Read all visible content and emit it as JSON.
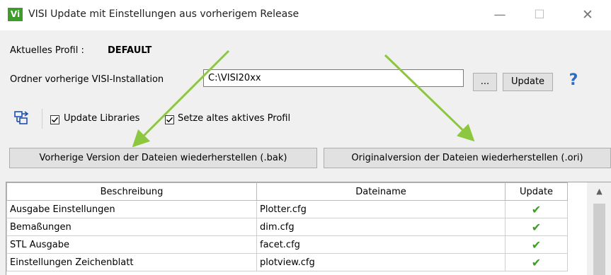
{
  "window": {
    "app_icon": "Vi",
    "title": "VISI Update mit Einstellungen aus vorherigem Release",
    "min_glyph": "—",
    "max_glyph": "☐",
    "close_glyph": "✕"
  },
  "profile": {
    "label": "Aktuelles Profil :",
    "value": "DEFAULT"
  },
  "folder": {
    "label": "Ordner vorherige VISI-Installation",
    "value": "C:\\VISI20xx",
    "browse_label": "...",
    "update_label": "Update",
    "help_glyph": "?"
  },
  "options": {
    "update_libraries": {
      "label": "Update Libraries",
      "checked": true
    },
    "set_old_profile": {
      "label": "Setze altes aktives Profil",
      "checked": true
    }
  },
  "actions": {
    "restore_bak": "Vorherige Version der Dateien wiederherstellen (.bak)",
    "restore_ori": "Originalversion der Dateien wiederherstellen (.ori)"
  },
  "table": {
    "headers": [
      "Beschreibung",
      "Dateiname",
      "Update"
    ],
    "rows": [
      {
        "description": "Ausgabe Einstellungen",
        "file": "Plotter.cfg",
        "update": "✔"
      },
      {
        "description": "Bemaßungen",
        "file": "dim.cfg",
        "update": "✔"
      },
      {
        "description": "STL Ausgabe",
        "file": "facet.cfg",
        "update": "✔"
      },
      {
        "description": "Einstellungen Zeichenblatt",
        "file": "plotview.cfg",
        "update": "✔"
      }
    ]
  },
  "colors": {
    "accent_green": "#3a9f22",
    "arrow_green": "#8dc63f",
    "help_blue": "#2b6cc4"
  },
  "icons": {
    "toolbar": "export-settings-icon",
    "scroll_up": "▲"
  }
}
